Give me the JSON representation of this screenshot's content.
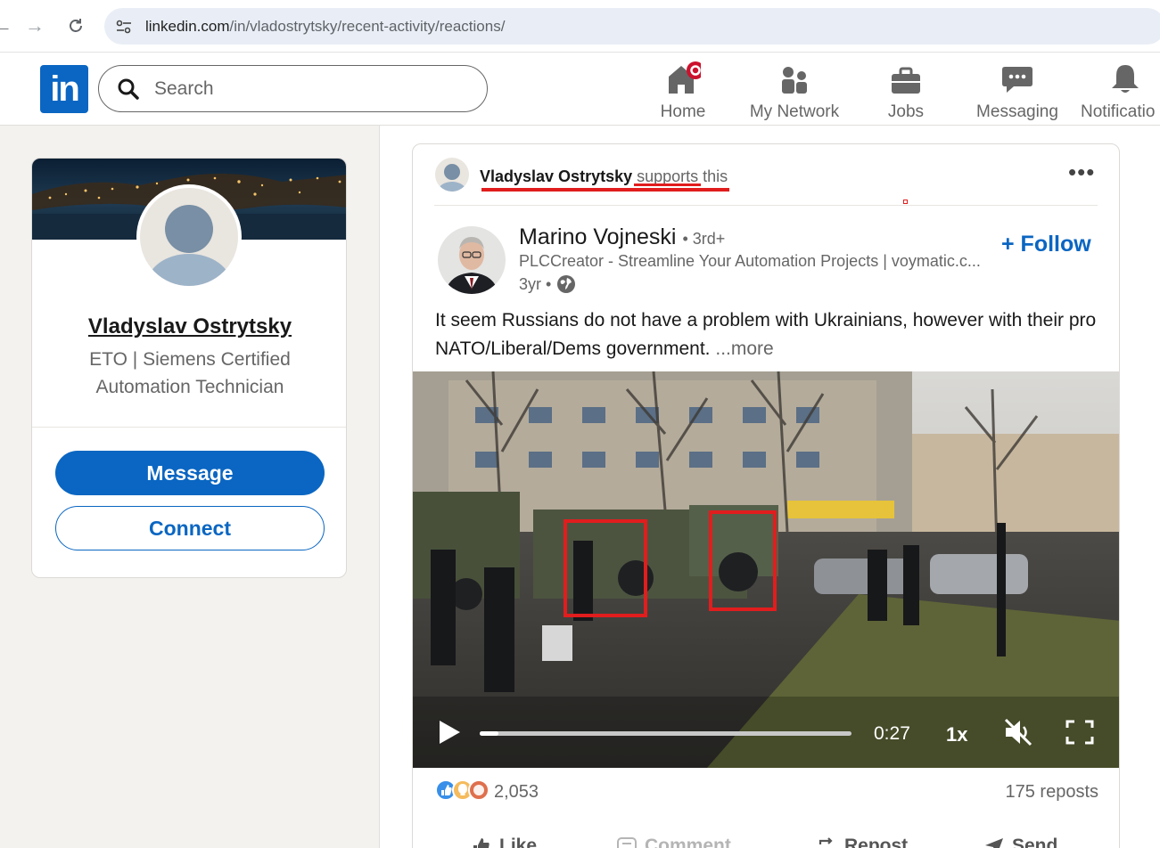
{
  "browser": {
    "url": "linkedin.com/in/vladostrytsky/recent-activity/reactions/",
    "url_host": "linkedin.com",
    "url_path": "/in/vladostrytsky/recent-activity/reactions/"
  },
  "header": {
    "logo": "in",
    "search": {
      "placeholder": "Search"
    },
    "nav": [
      {
        "label": "Home",
        "icon": "home-icon",
        "badge": true
      },
      {
        "label": "My Network",
        "icon": "network-icon"
      },
      {
        "label": "Jobs",
        "icon": "briefcase-icon"
      },
      {
        "label": "Messaging",
        "icon": "messaging-icon"
      },
      {
        "label": "Notificatio",
        "icon": "bell-icon"
      }
    ]
  },
  "profile": {
    "name": "Vladyslav Ostrytsky",
    "headline": "ETO | Siemens Certified Automation Technician",
    "message_label": "Message",
    "connect_label": "Connect"
  },
  "post": {
    "context_name": "Vladyslav Ostrytsky",
    "context_action": "supports this",
    "author": {
      "name": "Marino Vojneski",
      "degree": "• 3rd+",
      "headline": "PLCCreator - Streamline Your Automation Projects | voymatic.c...",
      "time": "3yr •"
    },
    "follow_label": "+ Follow",
    "text": "It seem Russians do not have a problem with Ukrainians, however with their pro NATO/Liberal/Dems government.",
    "more_label": "...more",
    "video": {
      "time": "0:27",
      "speed": "1x",
      "progress": 0.05,
      "muted": true
    },
    "reaction_count": "2,053",
    "reposts": "175 reposts",
    "actions": [
      "Like",
      "Comment",
      "Repost",
      "Send"
    ]
  },
  "colors": {
    "brand": "#0a66c2",
    "annotation": "#e11d1d",
    "badge": "#cb112d"
  }
}
